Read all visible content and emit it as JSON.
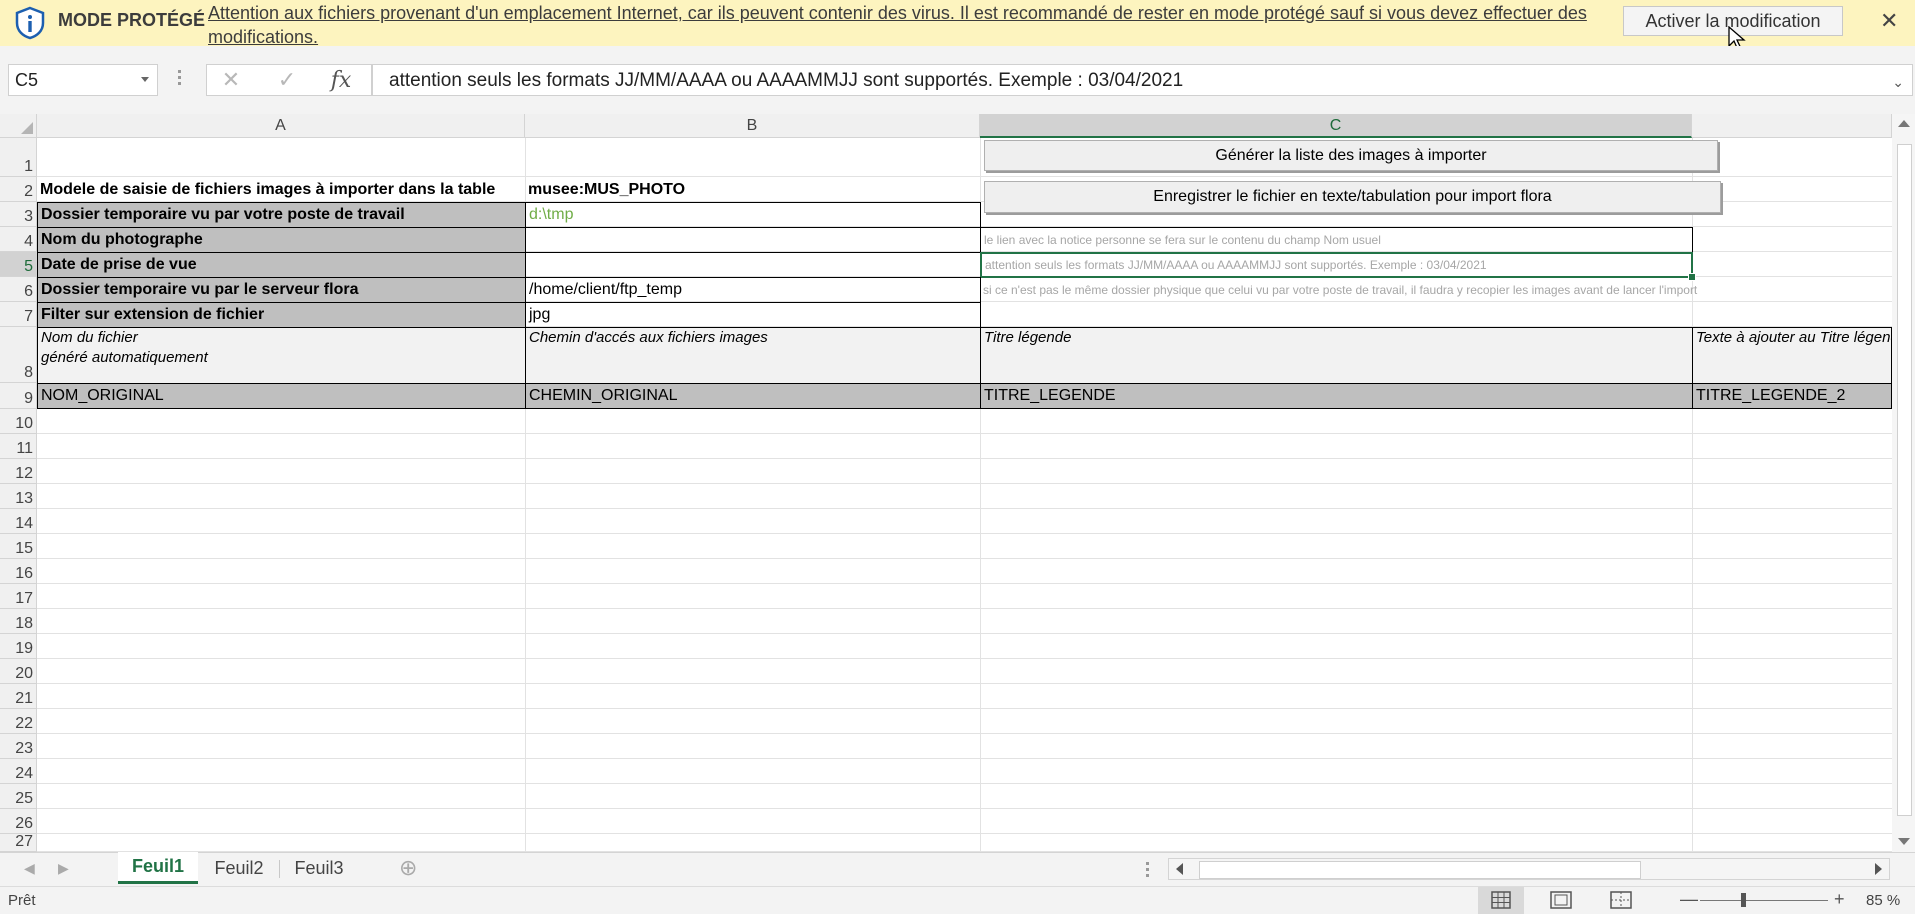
{
  "protected_bar": {
    "title": "MODE PROTÉGÉ",
    "message": "Attention aux fichiers provenant d'un emplacement Internet, car ils peuvent contenir des virus. Il est recommandé de rester en mode protégé sauf si vous devez effectuer des modifications.",
    "enable_button": "Activer la modification",
    "close_glyph": "✕"
  },
  "formula_bar": {
    "name_box": "C5",
    "cancel_glyph": "✕",
    "enter_glyph": "✓",
    "fx_glyph": "fx",
    "content": "attention seuls les formats JJ/MM/AAAA ou AAAAMMJJ sont supportés. Exemple : 03/04/2021"
  },
  "columns": [
    "A",
    "B",
    "C"
  ],
  "rows": [
    "1",
    "2",
    "3",
    "4",
    "5",
    "6",
    "7",
    "8",
    "9",
    "10",
    "11",
    "12",
    "13",
    "14",
    "15",
    "16",
    "17",
    "18",
    "19",
    "20",
    "21",
    "22",
    "23",
    "24",
    "25",
    "26",
    "27"
  ],
  "buttons": {
    "generate": "Générer la liste des images à importer",
    "save": "Enregistrer le fichier en texte/tabulation pour import flora"
  },
  "cells": {
    "A2": "Modele de saisie de fichiers images à importer dans la table",
    "B2": "musee:MUS_PHOTO",
    "A3": "Dossier temporaire vu par votre poste de travail",
    "B3": "d:\\tmp",
    "A4": "Nom du photographe",
    "C4": "le lien avec la notice personne se fera sur le contenu du champ Nom usuel",
    "A5": "Date de prise de vue",
    "C5": "attention seuls les formats JJ/MM/AAAA ou AAAAMMJJ sont supportés. Exemple : 03/04/2021",
    "A6": "Dossier temporaire vu par le serveur flora",
    "B6": "/home/client/ftp_temp",
    "C6": "si ce n'est pas le même dossier physique que celui vu par votre poste de travail, il faudra y recopier les images avant de lancer l'import",
    "A7": "Filter sur extension de fichier",
    "B7": "jpg",
    "A8_line1": "Nom du fichier",
    "A8_line2": "généré automatiquement",
    "B8": "Chemin d'accés aux fichiers  images",
    "C8": "Titre légende",
    "D8": "Texte à ajouter au Titre légende",
    "A9": "NOM_ORIGINAL",
    "B9": "CHEMIN_ORIGINAL",
    "C9": "TITRE_LEGENDE",
    "D9": "TITRE_LEGENDE_2"
  },
  "sheet_tabs": [
    "Feuil1",
    "Feuil2",
    "Feuil3"
  ],
  "add_sheet_glyph": "⊕",
  "status": {
    "mode": "Prêt",
    "zoom": "85 %"
  },
  "colors": {
    "protected_bar_bg": "#fdf4bf",
    "accent_green": "#217346",
    "header_cell_grey": "#bfbfbf",
    "path_text_green": "#70ad47"
  }
}
